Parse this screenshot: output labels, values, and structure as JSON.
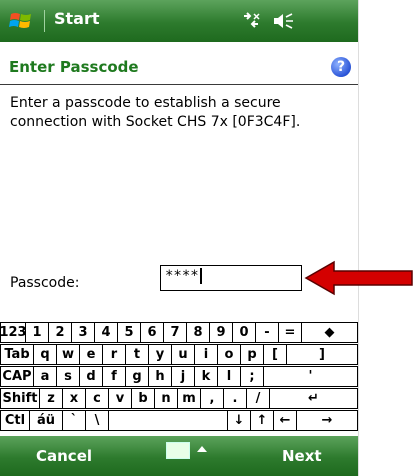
{
  "titlebar": {
    "title": "Start"
  },
  "header": {
    "title": "Enter Passcode",
    "help_glyph": "?"
  },
  "body": {
    "message": "Enter a passcode to establish a secure connection with Socket CHS 7x [0F3C4F].",
    "passcode_label": "Passcode:",
    "passcode_value": "****"
  },
  "keyboard": {
    "rows": [
      [
        "123",
        "1",
        "2",
        "3",
        "4",
        "5",
        "6",
        "7",
        "8",
        "9",
        "0",
        "-",
        "=",
        "◆"
      ],
      [
        "Tab",
        "q",
        "w",
        "e",
        "r",
        "t",
        "y",
        "u",
        "i",
        "o",
        "p",
        "[",
        "]"
      ],
      [
        "CAP",
        "a",
        "s",
        "d",
        "f",
        "g",
        "h",
        "j",
        "k",
        "l",
        ";",
        "'"
      ],
      [
        "Shift",
        "z",
        "x",
        "c",
        "v",
        "b",
        "n",
        "m",
        ",",
        ".",
        "/",
        "↵"
      ],
      [
        "Ctl",
        "áü",
        "`",
        "\\",
        " ",
        "↓",
        "↑",
        "←",
        "→"
      ]
    ]
  },
  "softkeys": {
    "left": "Cancel",
    "right": "Next"
  },
  "colors": {
    "bar_green": "#2d7a2d",
    "header_green": "#1f7a1f",
    "arrow_red": "#d40000"
  }
}
